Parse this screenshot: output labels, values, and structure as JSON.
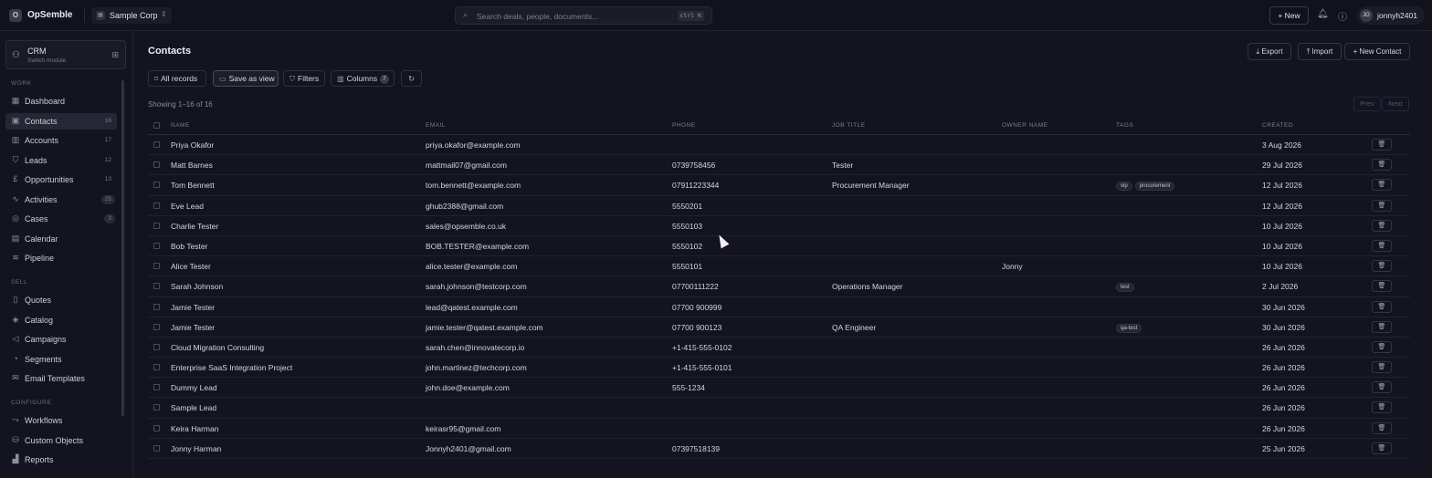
{
  "app": {
    "logo_letter": "O",
    "name": "OpSemble"
  },
  "org": {
    "icon": "building-icon",
    "name": "Sample Corp"
  },
  "search": {
    "placeholder": "Search deals, people, documents...",
    "shortcut": "ctrl K"
  },
  "topbar": {
    "new_label": "New",
    "user_initials": "JO",
    "user_name": "jonnyh2401"
  },
  "module": {
    "name": "CRM",
    "subtitle": "Switch module"
  },
  "nav": {
    "work_label": "WORK",
    "sell_label": "SELL",
    "configure_label": "CONFIGURE",
    "work_items": [
      {
        "label": "Dashboard",
        "icon": "grid-icon",
        "count": ""
      },
      {
        "label": "Contacts",
        "icon": "contacts-icon",
        "count": "16"
      },
      {
        "label": "Accounts",
        "icon": "building-icon",
        "count": "17"
      },
      {
        "label": "Leads",
        "icon": "funnel-icon",
        "count": "12"
      },
      {
        "label": "Opportunities",
        "icon": "pound-icon",
        "count": "13"
      },
      {
        "label": "Activities",
        "icon": "activity-icon",
        "count": "25"
      },
      {
        "label": "Cases",
        "icon": "lifebuoy-icon",
        "count": "3"
      },
      {
        "label": "Calendar",
        "icon": "calendar-icon",
        "count": ""
      },
      {
        "label": "Pipeline",
        "icon": "pipeline-icon",
        "count": ""
      }
    ],
    "sell_items": [
      {
        "label": "Quotes",
        "icon": "document-icon"
      },
      {
        "label": "Catalog",
        "icon": "box-icon"
      },
      {
        "label": "Campaigns",
        "icon": "megaphone-icon"
      },
      {
        "label": "Segments",
        "icon": "segments-icon"
      },
      {
        "label": "Email Templates",
        "icon": "mail-icon"
      }
    ],
    "configure_items": [
      {
        "label": "Workflows",
        "icon": "workflow-icon"
      },
      {
        "label": "Custom Objects",
        "icon": "database-icon"
      },
      {
        "label": "Reports",
        "icon": "report-icon"
      }
    ]
  },
  "page": {
    "title": "Contacts",
    "export_label": "Export",
    "import_label": "Import",
    "new_contact_label": "New Contact"
  },
  "toolbar": {
    "all_records": "All records",
    "save_view": "Save as view",
    "filters": "Filters",
    "columns": "Columns",
    "columns_count": "7"
  },
  "list": {
    "showing": "Showing 1–16 of 16",
    "prev": "Prev",
    "next": "Next"
  },
  "table": {
    "columns": [
      "NAME",
      "EMAIL",
      "PHONE",
      "JOB TITLE",
      "OWNER NAME",
      "TAGS",
      "CREATED"
    ],
    "rows": [
      {
        "name": "Priya Okafor",
        "email": "priya.okafor@example.com",
        "phone": "",
        "job": "",
        "owner": "",
        "tags": [],
        "created": "3 Aug 2026"
      },
      {
        "name": "Matt Barnes",
        "email": "mattmail07@gmail.com",
        "phone": "0739758456",
        "job": "Tester",
        "owner": "",
        "tags": [],
        "created": "29 Jul 2026"
      },
      {
        "name": "Tom Bennett",
        "email": "tom.bennett@example.com",
        "phone": "07911223344",
        "job": "Procurement Manager",
        "owner": "",
        "tags": [
          "vip",
          "procurement"
        ],
        "created": "12 Jul 2026"
      },
      {
        "name": "Eve Lead",
        "email": "ghub2388@gmail.com",
        "phone": "5550201",
        "job": "",
        "owner": "",
        "tags": [],
        "created": "12 Jul 2026"
      },
      {
        "name": "Charlie Tester",
        "email": "sales@opsemble.co.uk",
        "phone": "5550103",
        "job": "",
        "owner": "",
        "tags": [],
        "created": "10 Jul 2026"
      },
      {
        "name": "Bob Tester",
        "email": "BOB.TESTER@example.com",
        "phone": "5550102",
        "job": "",
        "owner": "",
        "tags": [],
        "created": "10 Jul 2026"
      },
      {
        "name": "Alice Tester",
        "email": "alice.tester@example.com",
        "phone": "5550101",
        "job": "",
        "owner": "Jonny",
        "tags": [],
        "created": "10 Jul 2026"
      },
      {
        "name": "Sarah Johnson",
        "email": "sarah.johnson@testcorp.com",
        "phone": "07700111222",
        "job": "Operations Manager",
        "owner": "",
        "tags": [
          "test"
        ],
        "created": "2 Jul 2026"
      },
      {
        "name": "Jamie Tester",
        "email": "lead@qatest.example.com",
        "phone": "07700 900999",
        "job": "",
        "owner": "",
        "tags": [],
        "created": "30 Jun 2026"
      },
      {
        "name": "Jamie Tester",
        "email": "jamie.tester@qatest.example.com",
        "phone": "07700 900123",
        "job": "QA Engineer",
        "owner": "",
        "tags": [
          "qa-test"
        ],
        "created": "30 Jun 2026"
      },
      {
        "name": "Cloud Migration Consulting",
        "email": "sarah.chen@innovatecorp.io",
        "phone": "+1-415-555-0102",
        "job": "",
        "owner": "",
        "tags": [],
        "created": "26 Jun 2026"
      },
      {
        "name": "Enterprise SaaS Integration Project",
        "email": "john.martinez@techcorp.com",
        "phone": "+1-415-555-0101",
        "job": "",
        "owner": "",
        "tags": [],
        "created": "26 Jun 2026"
      },
      {
        "name": "Dummy Lead",
        "email": "john.doe@example.com",
        "phone": "555-1234",
        "job": "",
        "owner": "",
        "tags": [],
        "created": "26 Jun 2026"
      },
      {
        "name": "Sample Lead",
        "email": "",
        "phone": "",
        "job": "",
        "owner": "",
        "tags": [],
        "created": "26 Jun 2026"
      },
      {
        "name": "Keira Harman",
        "email": "keirasr95@gmail.com",
        "phone": "",
        "job": "",
        "owner": "",
        "tags": [],
        "created": "26 Jun 2026"
      },
      {
        "name": "Jonny Harman",
        "email": "Jonnyh2401@gmail.com",
        "phone": "07397518139",
        "job": "",
        "owner": "",
        "tags": [],
        "created": "25 Jun 2026"
      }
    ]
  }
}
